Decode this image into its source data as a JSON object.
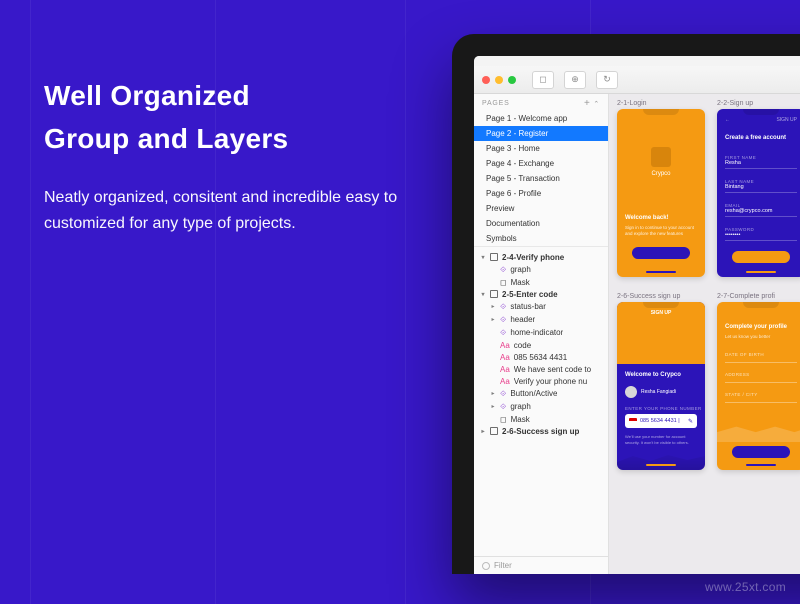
{
  "copy": {
    "heading_l1": "Well Organized",
    "heading_l2": "Group and Layers",
    "paragraph": "Neatly organized, consitent and incredible easy to customized for any type of projects."
  },
  "watermark": "www.25xt.com",
  "traffic_lights": {
    "close": "#ff5f57",
    "min": "#ffbd2e",
    "max": "#28c840"
  },
  "sidebar": {
    "header": "PAGES",
    "add_label": "+",
    "collapse_label": "⌃",
    "pages": [
      "Page 1 - Welcome app",
      "Page 2 - Register",
      "Page 3 - Home",
      "Page 4 - Exchange",
      "Page 5 - Transaction",
      "Page 6 - Profile",
      "Preview",
      "Documentation",
      "Symbols"
    ],
    "selected_index": 1,
    "layers": {
      "g1": {
        "name": "2-4-Verify phone",
        "children": [
          "graph",
          "Mask"
        ]
      },
      "g2": {
        "name": "2-5-Enter code",
        "children": [
          {
            "icon": "sym",
            "name": "status-bar"
          },
          {
            "icon": "sym",
            "name": "header"
          },
          {
            "icon": "sym",
            "name": "home-indicator"
          },
          {
            "icon": "txt",
            "name": "code"
          },
          {
            "icon": "txt",
            "name": "085 5634 4431"
          },
          {
            "icon": "txt",
            "name": "We have sent code to"
          },
          {
            "icon": "txt",
            "name": "Verify your phone nu"
          },
          {
            "icon": "sym",
            "name": "Button/Active"
          },
          {
            "icon": "grp",
            "name": "graph"
          },
          {
            "icon": "msk",
            "name": "Mask"
          }
        ]
      },
      "g3": {
        "name": "2-6-Success sign up"
      }
    },
    "filter_placeholder": "Filter"
  },
  "canvas": {
    "ab1": {
      "label": "2-1-Login",
      "name": "Crypco",
      "welcome_h": "Welcome back!",
      "welcome_sub": "Sign in to continue to your account and explore the new features"
    },
    "ab2": {
      "label": "2-2-Sign up",
      "back": "←",
      "step": "SIGN UP",
      "h": "Create a free account",
      "f1_lbl": "FIRST NAME",
      "f1_val": "Resha",
      "f2_lbl": "LAST NAME",
      "f2_val": "Bintang",
      "f3_lbl": "EMAIL",
      "f3_val": "resha@crypco.com",
      "f4_lbl": "PASSWORD",
      "f4_val": "••••••••"
    },
    "ab3": {
      "label": "2-6-Success sign up",
      "top_t": "SIGN UP",
      "h": "Welcome to Crypco",
      "avn": "Resha Fangiadi",
      "plbl": "ENTER YOUR PHONE NUMBER",
      "num": "085 5634 4431 |",
      "edit": "✎",
      "note": "We'll use your number for account security. It won't be visible to others."
    },
    "ab4": {
      "label": "2-7-Complete profi",
      "h": "Complete your profile",
      "sh": "Let us know you better",
      "f1_lbl": "DATE OF BIRTH",
      "f2_lbl": "ADDRESS",
      "f3_lbl": "STATE / CITY"
    }
  }
}
